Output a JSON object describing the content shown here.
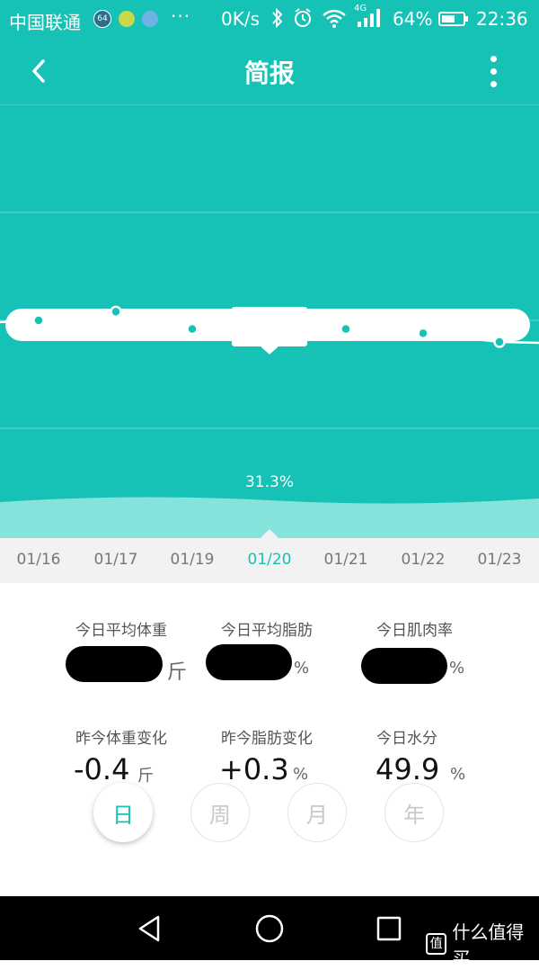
{
  "status_bar": {
    "carrier": "中国联通",
    "notif_badge": "64",
    "overflow": "···",
    "speed": "0K/s",
    "network_type": "4G",
    "battery_pct": "64%",
    "battery_level": 0.64,
    "time": "22:36"
  },
  "header": {
    "title": "简报"
  },
  "colors": {
    "brand": "#16c1b6",
    "wave": "#86e3dc",
    "text_muted": "#777777"
  },
  "chart_data": {
    "type": "line",
    "selected_index": 3,
    "x": [
      "01/16",
      "01/17",
      "01/19",
      "01/20",
      "01/21",
      "01/22",
      "01/23"
    ],
    "series": [
      {
        "values": [
          31.5,
          31.6,
          31.4,
          31.3,
          31.4,
          31.35,
          31.25
        ]
      }
    ],
    "ylim": [
      29.0,
      34.0
    ],
    "selected_value_label": "31.3%",
    "grid": true
  },
  "stats": {
    "avg_weight_label": "今日平均体重",
    "avg_weight_unit": "斤",
    "avg_fat_label": "今日平均脂肪",
    "avg_fat_unit": "%",
    "muscle_label": "今日肌肉率",
    "muscle_unit": "%",
    "weight_change_label": "昨今体重变化",
    "weight_change_value": "-0.4",
    "weight_change_unit": "斤",
    "fat_change_label": "昨今脂肪变化",
    "fat_change_value": "+0.3",
    "fat_change_unit": "%",
    "water_label": "今日水分",
    "water_value": "49.9",
    "water_unit": "%"
  },
  "range_tabs": [
    "日",
    "周",
    "月",
    "年"
  ],
  "watermark": "什么值得买"
}
